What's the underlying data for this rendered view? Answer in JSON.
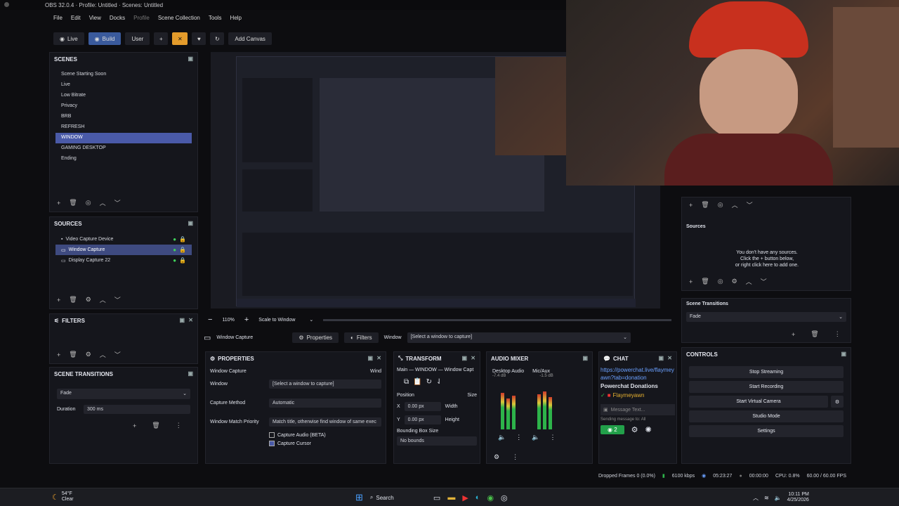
{
  "window": {
    "title": "OBS 32.0.4 · Profile: Untitled · Scenes: Untitled"
  },
  "menu": [
    "File",
    "Edit",
    "View",
    "Docks",
    "Profile",
    "Scene Collection",
    "Tools",
    "Help"
  ],
  "toolbar": {
    "live": "Live",
    "build": "Build",
    "user": "User",
    "plus": "+",
    "add_canvas": "Add Canvas"
  },
  "scenes": {
    "title": "Scenes",
    "items": [
      "Scene Starting Soon",
      "Live",
      "Low Bitrate",
      "Privacy",
      "BRB",
      "REFRESH",
      "WINDOW",
      "GAMING DESKTOP",
      "Ending"
    ],
    "selected": "WINDOW"
  },
  "sources": {
    "title": "Sources",
    "items": [
      "Video Capture Device",
      "Window Capture",
      "Display Capture 22"
    ],
    "selected": "Window Capture"
  },
  "filters": {
    "title": "Filters"
  },
  "scene_transitions": {
    "title": "Scene Transitions",
    "transition": "Fade",
    "duration_label": "Duration",
    "duration_value": "300 ms"
  },
  "preview_bar": {
    "zoom": "110%",
    "scale": "Scale to Window"
  },
  "source_bar": {
    "name": "Window Capture",
    "properties": "Properties",
    "filters": "Filters",
    "window_label": "Window",
    "window_value": "[Select a window to capture]"
  },
  "properties": {
    "title": "Properties",
    "source_name": "Window Capture",
    "source_name_right": "Wind",
    "window_label": "Window",
    "window_value": "[Select a window to capture]",
    "capture_method_label": "Capture Method",
    "capture_method_value": "Automatic",
    "match_label": "Window Match Priority",
    "match_value": "Match title, otherwise find window of same exec",
    "capture_audio": "Capture Audio (BETA)",
    "capture_cursor": "Capture Cursor"
  },
  "transform": {
    "title": "Transform",
    "subtitle": "Main — WINDOW — Window Capt",
    "position_label": "Position",
    "size_label": "Size",
    "x_label": "X",
    "y_label": "Y",
    "x_value": "0.00 px",
    "y_value": "0.00 px",
    "width_label": "Width",
    "height_label": "Height",
    "bounding_label": "Bounding Box Size",
    "bounding_value": "No bounds"
  },
  "audio": {
    "title": "Audio Mixer",
    "ch1": "Desktop Audio",
    "ch2": "Mic/Aux",
    "ch1_db": "-7.4 dB",
    "ch2_db": "-1.5 dB"
  },
  "chat": {
    "title": "Chat",
    "link": "https://powerchat.live/flaymeyawn?tab=donation",
    "heading": "Powerchat Donations",
    "user": "Flaymeyawn",
    "placeholder": "Message Text...",
    "sending": "Sending message to: All",
    "viewers": "2"
  },
  "right_sources": {
    "title": "Sources",
    "empty1": "You don't have any sources.",
    "empty2": "Click the + button below,",
    "empty3": "or right click here to add one."
  },
  "right_transitions": {
    "title": "Scene Transitions",
    "value": "Fade"
  },
  "controls": {
    "title": "Controls",
    "stop_streaming": "Stop Streaming",
    "start_recording": "Start Recording",
    "start_virtual_camera": "Start Virtual Camera",
    "studio_mode": "Studio Mode",
    "settings": "Settings"
  },
  "status": {
    "dropped": "Dropped Frames 0 (0.0%)",
    "bitrate": "6100 kbps",
    "stream_time": "05:23:27",
    "rec_time": "00:00:00",
    "cpu": "CPU: 0.8%",
    "fps": "60.00 / 60.00 FPS"
  },
  "taskbar": {
    "weather_temp": "54°F",
    "weather_desc": "Clear",
    "search": "Search",
    "time": "10:11 PM",
    "date": "4/25/2026"
  },
  "colors": {
    "accent": "#4a5aa8",
    "build_active": "#3a5a9c",
    "orange": "#e39b2b",
    "green": "#2db34a",
    "stream_btn": "#22a04a"
  }
}
